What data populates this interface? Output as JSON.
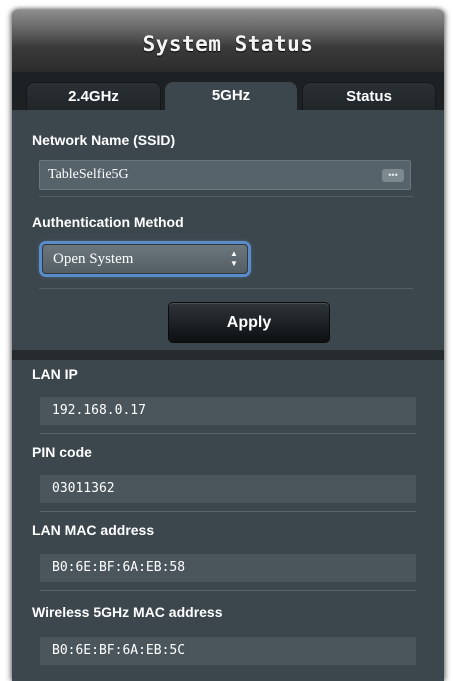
{
  "title": "System Status",
  "tabs": [
    {
      "label": "2.4GHz",
      "active": false
    },
    {
      "label": "5GHz",
      "active": true
    },
    {
      "label": "Status",
      "active": false
    }
  ],
  "wireless": {
    "ssid_label": "Network Name (SSID)",
    "ssid_value": "TableSelfie5G",
    "ssid_icon": "dots-icon",
    "auth_label": "Authentication Method",
    "auth_selected": "Open System",
    "apply_label": "Apply"
  },
  "info": {
    "lan_ip_label": "LAN IP",
    "lan_ip_value": "192.168.0.17",
    "pin_label": "PIN code",
    "pin_value": "03011362",
    "lan_mac_label": "LAN MAC address",
    "lan_mac_value": "B0:6E:BF:6A:EB:58",
    "wifi_mac_label": "Wireless 5GHz MAC address",
    "wifi_mac_value": "B0:6E:BF:6A:EB:5C"
  },
  "colors": {
    "panel_bg": "#3c474d",
    "tab_bar_bg": "#1d2124",
    "focus_ring": "#5a8cc9"
  }
}
